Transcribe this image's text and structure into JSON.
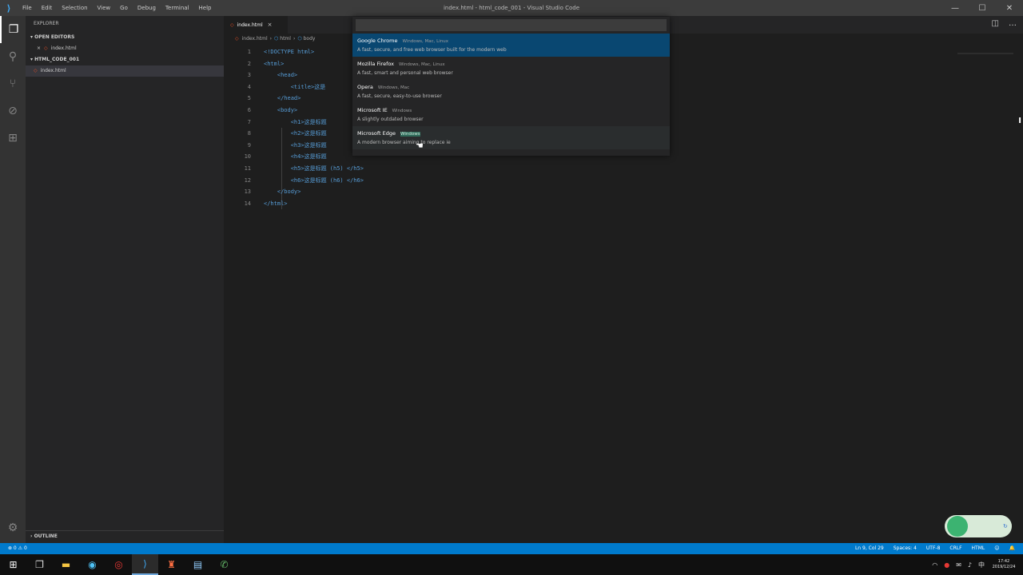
{
  "titlebar": {
    "app_icon": "vscode-logo-icon",
    "menu": [
      "File",
      "Edit",
      "Selection",
      "View",
      "Go",
      "Debug",
      "Terminal",
      "Help"
    ],
    "window_title": "index.html - html_code_001 - Visual Studio Code",
    "controls": {
      "minimize": "—",
      "maximize": "☐",
      "close": "✕"
    }
  },
  "activitybar": {
    "items": [
      "files-icon",
      "search-icon",
      "source-control-icon",
      "debug-icon",
      "extensions-icon"
    ],
    "bottom": "settings-gear-icon"
  },
  "sidebar": {
    "title": "EXPLORER",
    "open_editors": {
      "label": "OPEN EDITORS",
      "file": "index.html"
    },
    "folder": {
      "label": "HTML_CODE_001",
      "file": "index.html"
    },
    "outline": "OUTLINE"
  },
  "editor": {
    "tab": {
      "label": "index.html",
      "close": "×"
    },
    "breadcrumb": [
      "index.html",
      "html",
      "body"
    ],
    "lines": [
      {
        "n": "1",
        "text": "<!DOCTYPE html>"
      },
      {
        "n": "2",
        "text": "<html>"
      },
      {
        "n": "3",
        "text": "    <head>"
      },
      {
        "n": "4",
        "text": "        <title>这是"
      },
      {
        "n": "5",
        "text": "    </head>"
      },
      {
        "n": "6",
        "text": "    <body>"
      },
      {
        "n": "7",
        "text": "        <h1>这是标题"
      },
      {
        "n": "8",
        "text": "        <h2>这是标题"
      },
      {
        "n": "9",
        "text": "        <h3>这是标题"
      },
      {
        "n": "10",
        "text": "        <h4>这是标题"
      },
      {
        "n": "11",
        "text": "        <h5>这是标题 (h5) </h5>"
      },
      {
        "n": "12",
        "text": "        <h6>这是标题 (h6) </h6>"
      },
      {
        "n": "13",
        "text": "    </body>"
      },
      {
        "n": "14",
        "text": "</html>"
      }
    ]
  },
  "quickpick": {
    "input_value": "",
    "items": [
      {
        "name": "Google Chrome",
        "platforms": "Windows, Mac, Linux",
        "desc": "A fast, secure, and free web browser built for the modern web"
      },
      {
        "name": "Mozilla Firefox",
        "platforms": "Windows, Mac, Linux",
        "desc": "A fast, smart and personal web browser"
      },
      {
        "name": "Opera",
        "platforms": "Windows, Mac",
        "desc": "A fast, secure, easy-to-use browser"
      },
      {
        "name": "Microsoft IE",
        "platforms": "Windows",
        "desc": "A slightly outdated browser"
      },
      {
        "name": "Microsoft Edge",
        "platforms": "Windows",
        "desc": "A modern browser aiming to replace ie"
      }
    ]
  },
  "statusbar": {
    "left": "⊗ 0  ⚠ 0",
    "right": [
      "Ln 9, Col 29",
      "Spaces: 4",
      "UTF-8",
      "CRLF",
      "HTML",
      "☺",
      "🔔"
    ]
  },
  "taskbar": {
    "clock_time": "17:42",
    "clock_date": "2019/12/24"
  },
  "colors": {
    "statusbar": "#007acc",
    "selection": "#094771",
    "tag": "#569cd6"
  }
}
